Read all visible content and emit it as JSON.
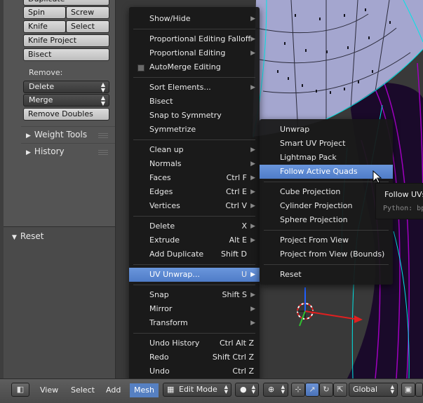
{
  "toolshelf": {
    "row_top_cut": "Duplicate",
    "spin": "Spin",
    "screw": "Screw",
    "knife": "Knife",
    "select": "Select",
    "knife_project": "Knife Project",
    "bisect": "Bisect",
    "remove_label": "Remove:",
    "delete": "Delete",
    "merge": "Merge",
    "remove_doubles": "Remove Doubles",
    "weight_tools": "Weight Tools",
    "history": "History",
    "reset": "Reset"
  },
  "mesh_menu": {
    "items": [
      {
        "label": "Show/Hide",
        "shortcut": "",
        "submenu": true
      },
      {
        "label": "Proportional Editing Falloff",
        "shortcut": "",
        "submenu": true
      },
      {
        "label": "Proportional Editing",
        "shortcut": "",
        "submenu": true
      },
      {
        "label": "AutoMerge Editing",
        "shortcut": "",
        "submenu": false
      },
      {
        "label": "Sort Elements...",
        "shortcut": "",
        "submenu": true
      },
      {
        "label": "Bisect",
        "shortcut": "",
        "submenu": false
      },
      {
        "label": "Snap to Symmetry",
        "shortcut": "",
        "submenu": false
      },
      {
        "label": "Symmetrize",
        "shortcut": "",
        "submenu": false
      },
      {
        "label": "Clean up",
        "shortcut": "",
        "submenu": true
      },
      {
        "label": "Normals",
        "shortcut": "",
        "submenu": true
      },
      {
        "label": "Faces",
        "shortcut": "Ctrl F",
        "submenu": true
      },
      {
        "label": "Edges",
        "shortcut": "Ctrl E",
        "submenu": true
      },
      {
        "label": "Vertices",
        "shortcut": "Ctrl V",
        "submenu": true
      },
      {
        "label": "Delete",
        "shortcut": "X",
        "submenu": true
      },
      {
        "label": "Extrude",
        "shortcut": "Alt E",
        "submenu": true
      },
      {
        "label": "Add Duplicate",
        "shortcut": "Shift D",
        "submenu": false
      },
      {
        "label": "UV Unwrap...",
        "shortcut": "U",
        "submenu": true
      },
      {
        "label": "Snap",
        "shortcut": "Shift S",
        "submenu": true
      },
      {
        "label": "Mirror",
        "shortcut": "",
        "submenu": true
      },
      {
        "label": "Transform",
        "shortcut": "",
        "submenu": true
      },
      {
        "label": "Undo History",
        "shortcut": "Ctrl Alt Z",
        "submenu": false
      },
      {
        "label": "Redo",
        "shortcut": "Shift Ctrl Z",
        "submenu": false
      },
      {
        "label": "Undo",
        "shortcut": "Ctrl Z",
        "submenu": false
      }
    ]
  },
  "uv_menu": {
    "items": [
      {
        "label": "Unwrap"
      },
      {
        "label": "Smart UV Project"
      },
      {
        "label": "Lightmap Pack"
      },
      {
        "label": "Follow Active Quads"
      },
      {
        "label": "Cube Projection"
      },
      {
        "label": "Cylinder Projection"
      },
      {
        "label": "Sphere Projection"
      },
      {
        "label": "Project From View"
      },
      {
        "label": "Project from View (Bounds)"
      },
      {
        "label": "Reset"
      }
    ]
  },
  "tooltip": {
    "title": "Follow UVs",
    "python": "Python: bp"
  },
  "header": {
    "view": "View",
    "select": "Select",
    "add": "Add",
    "mesh": "Mesh",
    "mode": "Edit Mode",
    "orientation": "Global"
  },
  "colors": {
    "highlight": "#5680c2",
    "mesh_fill": "#a4a6cf",
    "wire": "#00e5e5",
    "x_axis": "#e02020",
    "y_axis": "#30c030",
    "z_axis": "#2060ff"
  }
}
